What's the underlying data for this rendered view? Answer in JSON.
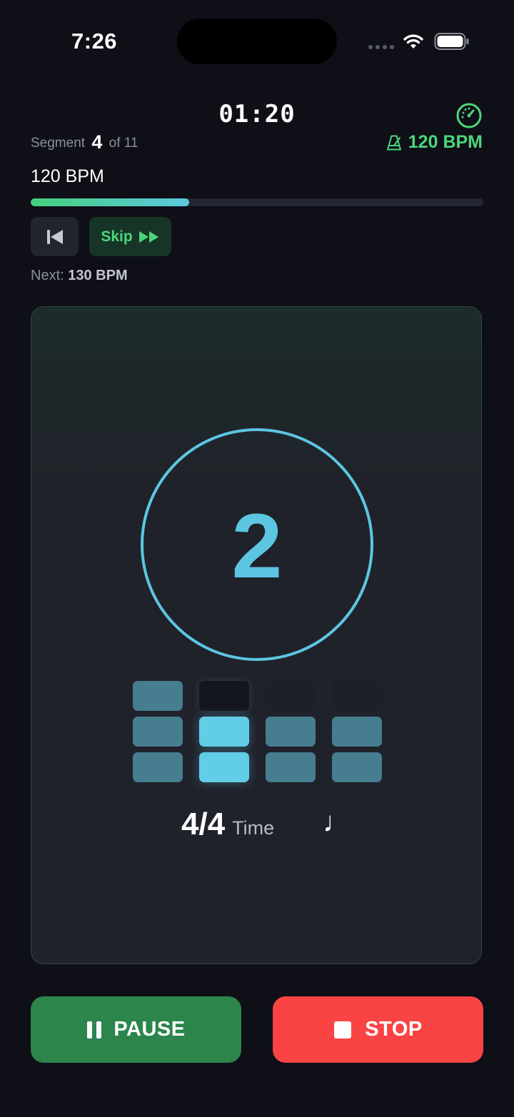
{
  "status_bar": {
    "time": "7:26",
    "icons": [
      "cellular-icon",
      "wifi-icon",
      "battery-icon"
    ]
  },
  "header": {
    "elapsed": "01:20",
    "segment_label": "Segment",
    "segment_current": "4",
    "segment_total": "of 11",
    "current_bpm": "120 BPM",
    "segment_bpm": "120 BPM",
    "progress": 0.35
  },
  "controls": {
    "skip_label": "Skip",
    "next_label": "Next:",
    "next_bpm": "130 BPM"
  },
  "beat": {
    "current": "2",
    "beats_per_bar": 4,
    "active_beat": 2,
    "time_signature": "4/4",
    "time_label": "Time",
    "note_symbol": "♩"
  },
  "actions": {
    "pause_label": "PAUSE",
    "stop_label": "STOP"
  },
  "colors": {
    "accent_green": "#4cd67a",
    "accent_blue": "#5cc6e2",
    "pause": "#2c864c",
    "stop": "#fa4444"
  }
}
